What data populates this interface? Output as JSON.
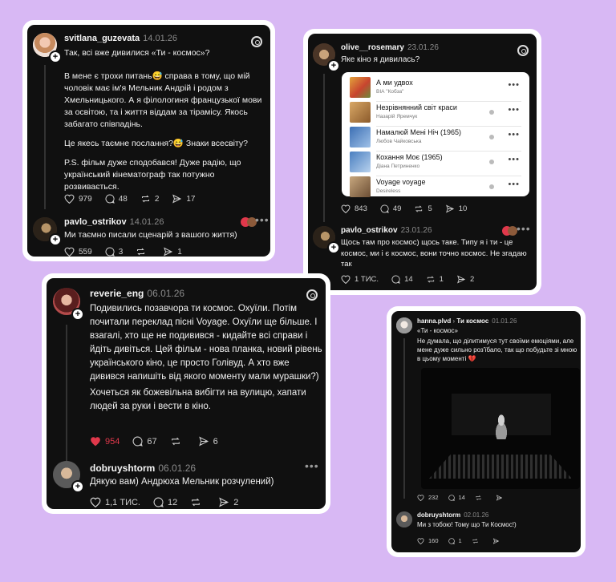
{
  "colors": {
    "background": "#d8b8f4",
    "card": "#101010",
    "liked": "#e0384b"
  },
  "card1": {
    "post": {
      "username": "svitlana_guzevata",
      "date": "14.01.26",
      "title": "Так, всі вже дивилися «Ти - космос»?",
      "p1": "В мене є трохи питань😅 справа в тому, що мій чоловік має ім'я Мельник Андрій і родом з Хмельницького. А я філологиня французької мови за освітою, та і життя віддам за тірамісу. Якось забагато співпадінь.",
      "p2": "Це якесь таємне послання?😅 Знаки всесвіту?",
      "p3": "P.S. фільм дуже сподобався! Дуже радію, що український кінематограф так потужно розвивається.",
      "likes": "979",
      "comments": "48",
      "reposts": "2",
      "shares": "17"
    },
    "reply": {
      "username": "pavlo_ostrikov",
      "date": "14.01.26",
      "text": "Ми таємно писали сценарій з вашого життя)",
      "likes": "559",
      "comments": "3",
      "reposts": "",
      "shares": "1"
    }
  },
  "card2": {
    "post": {
      "username": "olive__rosemary",
      "date": "23.01.26",
      "text": "Яке кіно я дивилась?",
      "likes": "843",
      "comments": "49",
      "reposts": "5",
      "shares": "10"
    },
    "playlist": [
      {
        "title": "А ми удвох",
        "artist": "ВІА \"Кобза\"",
        "explicit": false
      },
      {
        "title": "Незрівнянний світ краси",
        "artist": "Назарій Яремчук",
        "explicit": true
      },
      {
        "title": "Намалюй Мені Ніч  (1965)",
        "artist": "Любов Чайковська",
        "explicit": true
      },
      {
        "title": "Кохання Моє  (1965)",
        "artist": "Діана Петриненко",
        "explicit": true
      },
      {
        "title": "Voyage voyage",
        "artist": "Desireless",
        "explicit": true
      }
    ],
    "reply": {
      "username": "pavlo_ostrikov",
      "date": "23.01.26",
      "text": "Щось там про космос) щось таке. Типу я і ти - це космос, ми і є космос, вони точно космос. Не згадаю так",
      "likes": "1 ТИС.",
      "comments": "14",
      "reposts": "1",
      "shares": "2"
    }
  },
  "card3": {
    "post": {
      "username": "reverie_eng",
      "date": "06.01.26",
      "p1": "Подивились позавчора ти космос. Охуїли. Потім почитали переклад пісні Voyage. Охуїли ще більше. І взагалі, хто ще не подивився - кидайте всі справи і йдіть дивіться. Цей фільм - нова планка, новий рівень українського кіно, це просто Голівуд. А хто вже дивився напишіть від якого моменту мали мурашки?)",
      "p2": "Хочеться як божевільна вибігти на вулицю, хапати людей за руки і вести в кіно.",
      "likes": "954",
      "comments": "67",
      "reposts": "",
      "shares": "6"
    },
    "reply": {
      "username": "dobruyshtorm",
      "date": "06.01.26",
      "text": "Дякую вам) Андрюха Мельник розчулений)",
      "likes": "1,1 ТИС.",
      "comments": "12",
      "reposts": "",
      "shares": "2"
    }
  },
  "card4": {
    "post": {
      "username": "hanna.plvd",
      "topic": "Ти космос",
      "date": "01.01.26",
      "quote": "«Ти - космос»",
      "text": "Не думала, що ділитимуся тут своїми емоціями, але мене дуже сильно роз'їбало, так що побудьте зі мною в цьому моменті 💔",
      "likes": "232",
      "comments": "14",
      "reposts": "",
      "shares": ""
    },
    "reply": {
      "username": "dobruyshtorm",
      "date": "02.01.26",
      "text": "Ми з тобою! Тому що Ти Космос!)",
      "likes": "160",
      "comments": "1",
      "reposts": "",
      "shares": ""
    }
  }
}
